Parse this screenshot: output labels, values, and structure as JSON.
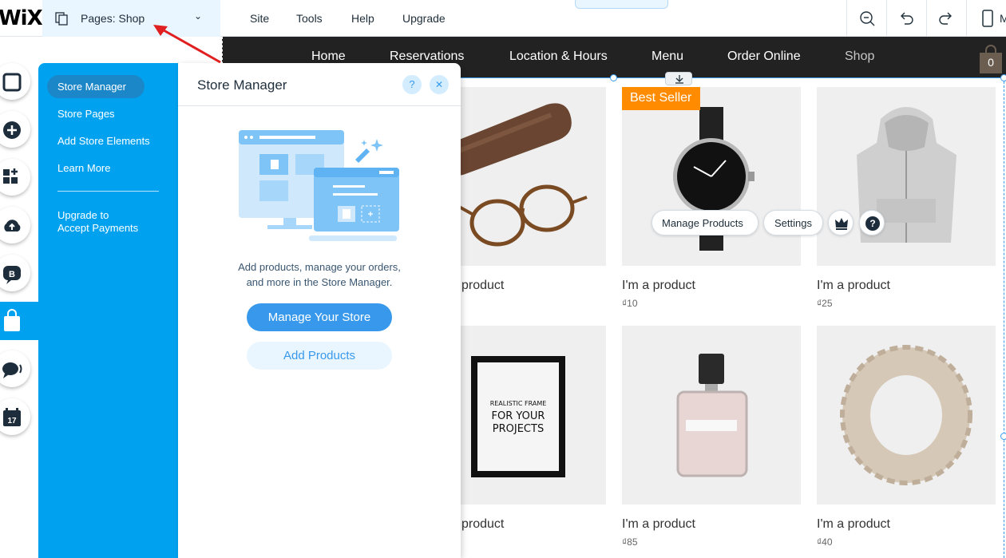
{
  "topbar": {
    "logo": "WiX",
    "pages_label": "Pages: Shop",
    "menu": [
      "Site",
      "Tools",
      "Help",
      "Upgrade"
    ],
    "mobile_label": "M"
  },
  "site": {
    "nav": [
      "Home",
      "Reservations",
      "Location & Hours",
      "Menu",
      "Order Online",
      "Shop"
    ],
    "active_nav": "Shop",
    "cart_count": "0"
  },
  "products": [
    {
      "name": "product",
      "price": ""
    },
    {
      "name": "I'm a product",
      "price": "₫10",
      "ribbon": "Best Seller"
    },
    {
      "name": "I'm a product",
      "price": "₫25"
    },
    {
      "name": "product",
      "price": ""
    },
    {
      "name": "I'm a product",
      "price": "₫85"
    },
    {
      "name": "I'm a product",
      "price": "₫40"
    }
  ],
  "frame_text": {
    "line1": "REALISTIC FRAME",
    "line2": "FOR YOUR",
    "line3": "PROJECTS"
  },
  "float_toolbar": {
    "manage_products": "Manage Products",
    "settings": "Settings"
  },
  "panel": {
    "title": "Store Manager",
    "side_items": [
      "Store Manager",
      "Store Pages",
      "Add Store Elements",
      "Learn More"
    ],
    "upgrade_line1": "Upgrade to",
    "upgrade_line2": "Accept Payments",
    "description_line1": "Add products, manage your orders,",
    "description_line2": "and more in the Store Manager.",
    "primary_button": "Manage Your Store",
    "secondary_button": "Add Products",
    "help_glyph": "?",
    "close_glyph": "✕"
  },
  "colors": {
    "accent": "#3899ec",
    "panel_blue": "#00a2f0",
    "ribbon": "#ff8b00",
    "site_nav": "#222222"
  }
}
